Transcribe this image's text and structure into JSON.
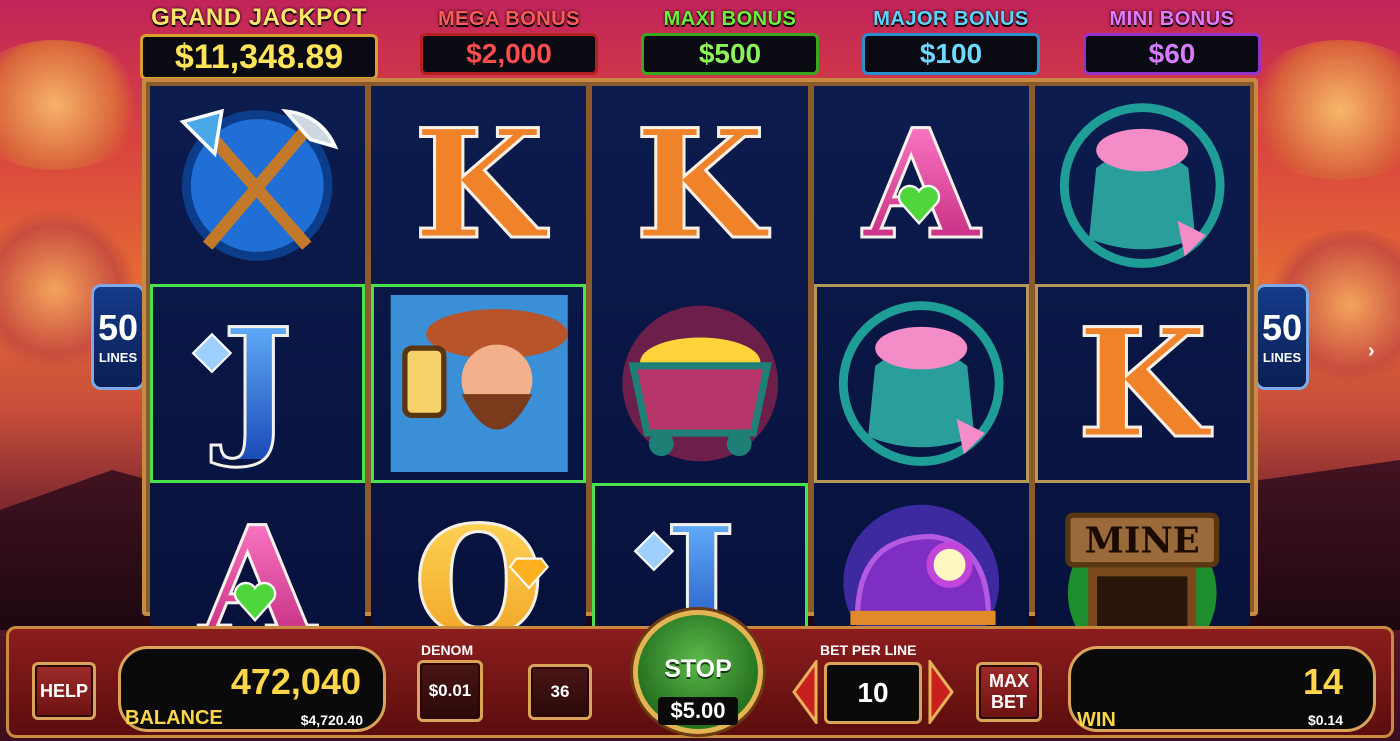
{
  "jackpots": {
    "grand": {
      "label": "GRAND JACKPOT",
      "value": "$11,348.89"
    },
    "mega": {
      "label": "MEGA BONUS",
      "value": "$2,000"
    },
    "maxi": {
      "label": "MAXI BONUS",
      "value": "$500"
    },
    "major": {
      "label": "MAJOR BONUS",
      "value": "$100"
    },
    "mini": {
      "label": "MINI BONUS",
      "value": "$60"
    }
  },
  "reels": [
    [
      {
        "symbol": "pick-shovel",
        "win": false
      },
      {
        "symbol": "J",
        "win": true
      },
      {
        "symbol": "A",
        "win": false
      }
    ],
    [
      {
        "symbol": "K",
        "win": false
      },
      {
        "symbol": "miner",
        "win": true
      },
      {
        "symbol": "Q",
        "win": false
      }
    ],
    [
      {
        "symbol": "K",
        "win": false
      },
      {
        "symbol": "gold-cart",
        "win": false
      },
      {
        "symbol": "J",
        "win": true
      }
    ],
    [
      {
        "symbol": "A",
        "win": false
      },
      {
        "symbol": "gem-bag",
        "win": false
      },
      {
        "symbol": "helmet",
        "win": false
      }
    ],
    [
      {
        "symbol": "gem-bag",
        "win": false
      },
      {
        "symbol": "K",
        "win": false
      },
      {
        "symbol": "mine",
        "win": false
      }
    ]
  ],
  "lines_indicator": {
    "value": "50",
    "label": "LINES"
  },
  "mine_sign": "MINE",
  "controls": {
    "help": "HELP",
    "balance_credits": "472,040",
    "balance_label": "BALANCE",
    "balance_money": "$4,720.40",
    "denom_label": "DENOM",
    "denom_value": "$0.01",
    "lines_value": "36",
    "stop_label": "STOP",
    "stop_bet": "$5.00",
    "bet_per_line_label": "BET PER LINE",
    "bet_per_line_value": "10",
    "max_bet": "MAX BET",
    "win_credits": "14",
    "win_label": "WIN",
    "win_money": "$0.14"
  },
  "colors": {
    "win_highlight": "#49e24a",
    "panel": "#8d1d1d",
    "gold": "#ffd54a"
  }
}
